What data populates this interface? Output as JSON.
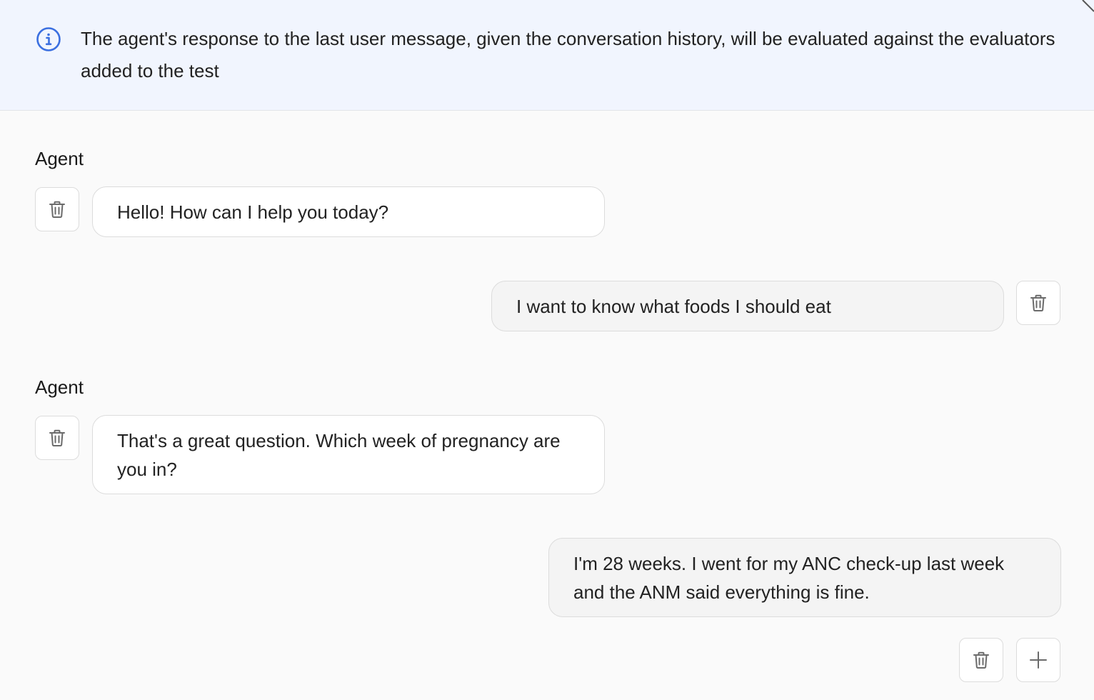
{
  "info_banner": {
    "icon": "info-circle-icon",
    "text": "The agent's response to the last user message, given the conversation history, will be evaluated against the evaluators added to the test"
  },
  "conversation": [
    {
      "role": "agent",
      "role_label": "Agent",
      "text": "Hello! How can I help you today?"
    },
    {
      "role": "user",
      "text": "I want to know what foods I should eat"
    },
    {
      "role": "agent",
      "role_label": "Agent",
      "text": "That's a great question. Which week of pregnancy are you in?"
    },
    {
      "role": "user",
      "text": "I'm 28 weeks. I went for my ANC check-up last week and the ANM said everything is fine."
    }
  ],
  "actions": {
    "delete_icon": "trash-icon",
    "add_icon": "plus-icon"
  },
  "colors": {
    "banner_bg": "#f1f5fe",
    "accent": "#3b6fe0",
    "agent_bubble_bg": "#ffffff",
    "user_bubble_bg": "#f4f4f4"
  }
}
